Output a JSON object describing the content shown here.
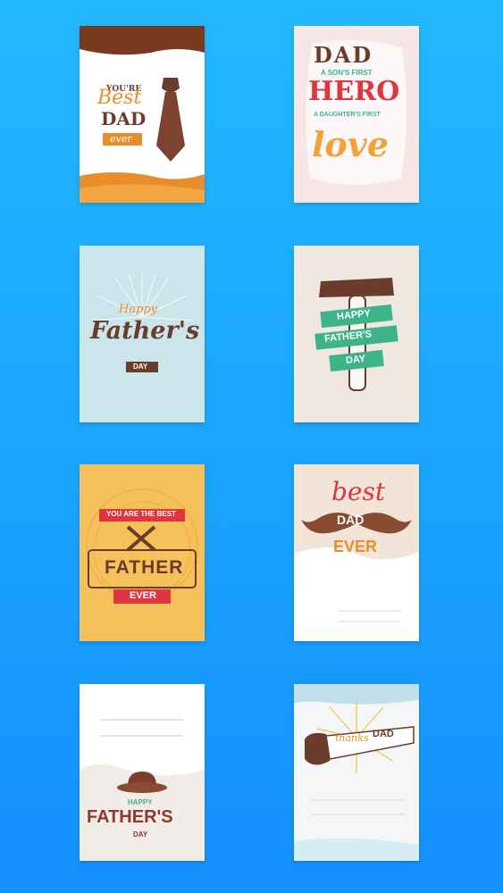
{
  "cards": [
    {
      "line1": "YOU'RE",
      "line2": "Best",
      "line3": "DAD",
      "line4": "ever"
    },
    {
      "line1": "DAD",
      "line2": "A SON'S FIRST",
      "line3": "HERO",
      "line4": "A DAUGHTER'S FIRST",
      "line5": "love"
    },
    {
      "line1": "Happy",
      "line2": "Father's",
      "line3": "DAY"
    },
    {
      "line1": "HAPPY",
      "line2": "FATHER'S",
      "line3": "DAY"
    },
    {
      "line1": "YOU ARE THE BEST",
      "line2": "FATHER",
      "line3": "EVER"
    },
    {
      "line1": "best",
      "line2": "DAD",
      "line3": "EVER"
    },
    {
      "line1": "HAPPY",
      "line2": "FATHER'S",
      "line3": "DAY"
    },
    {
      "line1": "thanks",
      "line2": "DAD"
    }
  ],
  "colors": {
    "brown": "#6b3b2b",
    "orange": "#e98d2a",
    "green": "#3db38a",
    "red": "#e0343f",
    "blue": "#1aa3ff"
  },
  "icons": [
    "tie-icon",
    "hammer-icon",
    "tools-icon",
    "mustache-icon",
    "hat-icon",
    "saw-icon"
  ]
}
